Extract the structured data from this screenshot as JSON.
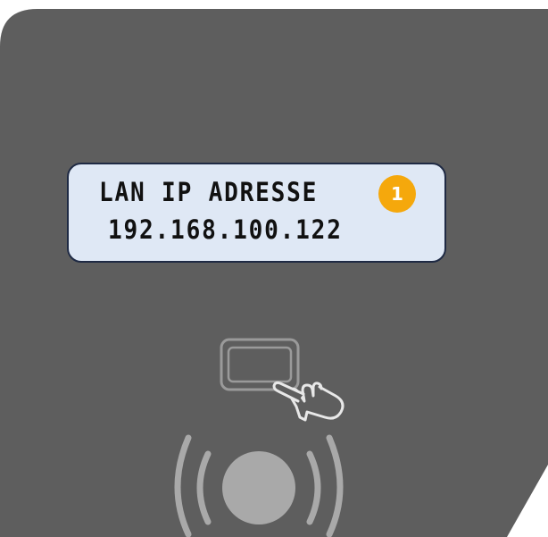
{
  "device": {
    "lcd": {
      "line1": "LAN IP ADRESSE",
      "line2": "192.168.100.122",
      "background": "#dfe8f5"
    },
    "callout_badge": {
      "label": "1",
      "color": "#f5a80c"
    },
    "panel_color": "#5e5e5e",
    "icons": [
      "card-tap-icon",
      "nfc-reader-icon"
    ]
  }
}
